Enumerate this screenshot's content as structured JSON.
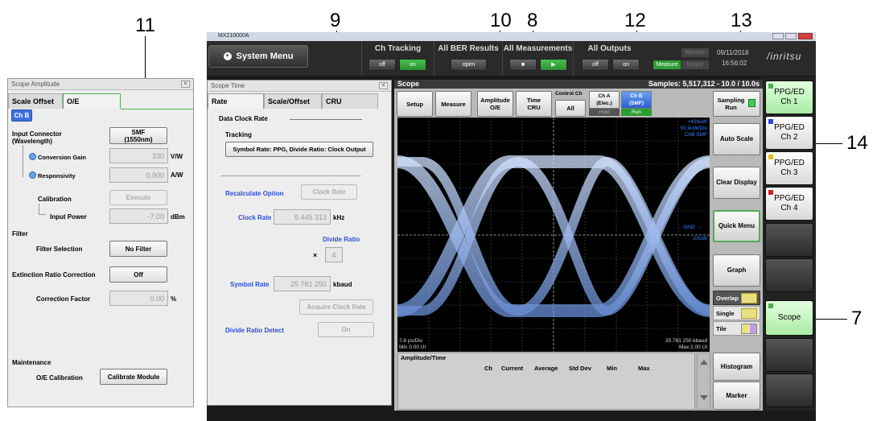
{
  "callouts": [
    "11",
    "9",
    "10",
    "8",
    "12",
    "13",
    "14",
    "7"
  ],
  "amp_panel": {
    "title": "Scope Amplitude",
    "tabs": [
      "Scale Offset",
      "O/E"
    ],
    "channel": "Ch B",
    "input_connector_label": "Input Connector\n(Wavelength)",
    "input_connector_value": "SMF\n(1550nm)",
    "conversion_gain_label": "Conversion Gain",
    "conversion_gain_value": "330",
    "conversion_gain_unit": "V/W",
    "responsivity_label": "Responsivity",
    "responsivity_value": "0.900",
    "responsivity_unit": "A/W",
    "calibration_label": "Calibration",
    "execute_label": "Execute",
    "input_power_label": "Input Power",
    "input_power_value": "-7.00",
    "input_power_unit": "dBm",
    "filter_label": "Filter",
    "filter_selection_label": "Filter Selection",
    "filter_selection_value": "No Filter",
    "extinction_label": "Extinction Ratio Correction",
    "extinction_value": "Off",
    "correction_factor_label": "Correction Factor",
    "correction_factor_value": "0.00",
    "correction_factor_unit": "%",
    "maintenance_label": "Maintenance",
    "oe_calibration_label": "O/E Calibration",
    "calibrate_module_label": "Calibrate Module"
  },
  "window": {
    "title": "MX210000A"
  },
  "toolbar": {
    "system_menu": "System Menu",
    "ch_tracking": {
      "title": "Ch Tracking",
      "off": "off",
      "on": "on"
    },
    "all_ber": {
      "title": "All BER Results",
      "open": "open"
    },
    "all_meas": {
      "title": "All Measurements",
      "stop": "■",
      "start": "▶"
    },
    "all_outputs": {
      "title": "All Outputs",
      "off": "off",
      "on": "on"
    },
    "remote": "Remote",
    "measure": "Measure",
    "output": "Output",
    "date": "09/11/2018",
    "time": "16:56:02",
    "brand": "/inritsu"
  },
  "time_panel": {
    "title": "Scope Time",
    "tabs": [
      "Rate",
      "Scale/Offset",
      "CRU"
    ],
    "section": "Data Clock Rate",
    "tracking_label": "Tracking",
    "tracking_value": "Symbol Rate: PPG, Divide Ratio: Clock Output",
    "recalc_label": "Recalculate Option",
    "clock_rate_btn": "Clock Rate",
    "clock_rate_label": "Clock Rate",
    "clock_rate_value": "6 445 313",
    "clock_rate_unit": "kHz",
    "divide_ratio_label": "Divide Ratio",
    "times": "×",
    "divide_ratio_value": "4",
    "symbol_rate_label": "Symbol Rate",
    "symbol_rate_value": "25 781 250",
    "symbol_rate_unit": "kbaud",
    "acquire_label": "Acquire Clock Rate",
    "divide_detect_label": "Divide Ratio Detect",
    "divide_detect_value": "On"
  },
  "scope": {
    "title": "Scope",
    "samples": "Samples: 5,517,312 - 10.0 / 10.0s",
    "buttons": {
      "setup": "Setup",
      "measure": "Measure",
      "amplitude": "Amplitude\nO/E",
      "time": "Time\nCRU",
      "control_ch": "Control Ch",
      "all": "All",
      "cha": "Ch A\n(Elec.)",
      "cha_state": "Hold",
      "chb": "Ch B\n(SMF)",
      "chb_state": "Run",
      "sampling": "Sampling\nRun"
    },
    "readouts": {
      "top_right": "+439uW\n91.9uW/Div\nChB SMF",
      "gnd": "GND →",
      "mid_right": "-20uW",
      "bottom_left": "7.8 ps/Div\nMin 0.00 UI",
      "bottom_right": "25 781 250 kbaud\nMax 2.00 UI"
    },
    "table": {
      "title": "Amplitude/Time",
      "headers": [
        "Ch",
        "Current",
        "Average",
        "Std Dev",
        "Min",
        "Max"
      ]
    },
    "right_buttons": {
      "auto_scale": "Auto Scale",
      "clear_display": "Clear Display",
      "quick_menu": "Quick Menu",
      "graph": "Graph",
      "overlap": "Overlap",
      "single": "Single",
      "tile": "Tile",
      "histogram": "Histogram",
      "marker": "Marker"
    }
  },
  "channels": [
    {
      "label": "PPG/ED\nCh 1",
      "color": "#4caf50"
    },
    {
      "label": "PPG/ED\nCh 2",
      "color": "#2848e0"
    },
    {
      "label": "PPG/ED\nCh 3",
      "color": "#e0c020"
    },
    {
      "label": "PPG/ED\nCh 4",
      "color": "#d02020"
    },
    {
      "label": "Scope",
      "color": "#4caf50"
    }
  ]
}
